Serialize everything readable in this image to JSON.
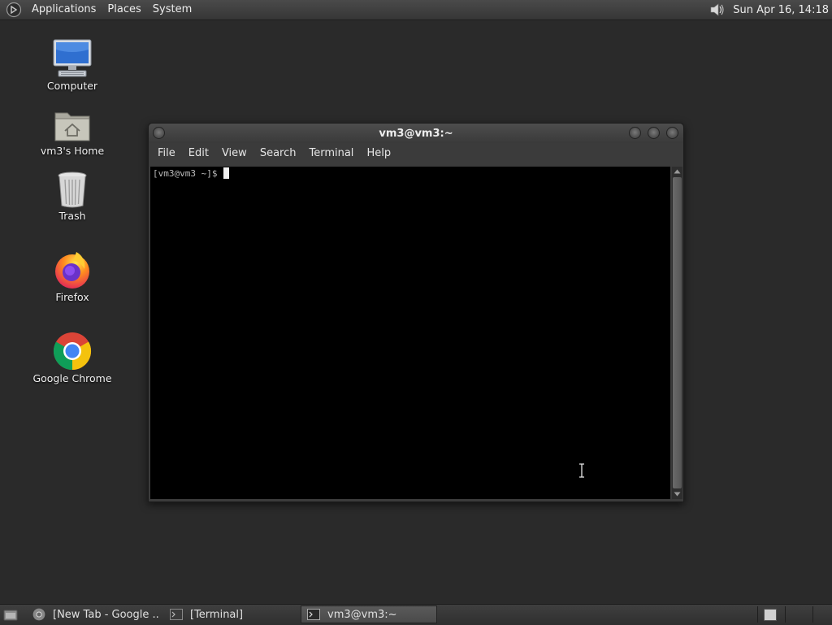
{
  "top_panel": {
    "menus": [
      "Applications",
      "Places",
      "System"
    ],
    "clock": "Sun Apr 16, 14:18",
    "icons": [
      "gnome-foot-logo-icon",
      "volume-icon"
    ]
  },
  "desktop_icons": [
    {
      "label": "Computer",
      "icon": "computer-icon"
    },
    {
      "label": "vm3's Home",
      "icon": "home-folder-icon"
    },
    {
      "label": "Trash",
      "icon": "trash-icon"
    },
    {
      "label": "Firefox",
      "icon": "firefox-icon"
    },
    {
      "label": "Google Chrome",
      "icon": "chrome-icon"
    }
  ],
  "terminal": {
    "title": "vm3@vm3:~",
    "menu": [
      "File",
      "Edit",
      "View",
      "Search",
      "Terminal",
      "Help"
    ],
    "prompt": "[vm3@vm3 ~]$ "
  },
  "taskbar": {
    "tasks": [
      {
        "label": "[New Tab - Google ...",
        "icon": "chrome-icon"
      },
      {
        "label": "[Terminal]",
        "icon": "terminal-icon"
      },
      {
        "label": "vm3@vm3:~",
        "icon": "terminal-icon",
        "active": true
      }
    ]
  },
  "colors": {
    "desktop_bg": "#2a2a2a",
    "panel_bg": "#3c3c3c",
    "terminal_bg": "#000000",
    "prompt_text": "#bdbdbd"
  }
}
